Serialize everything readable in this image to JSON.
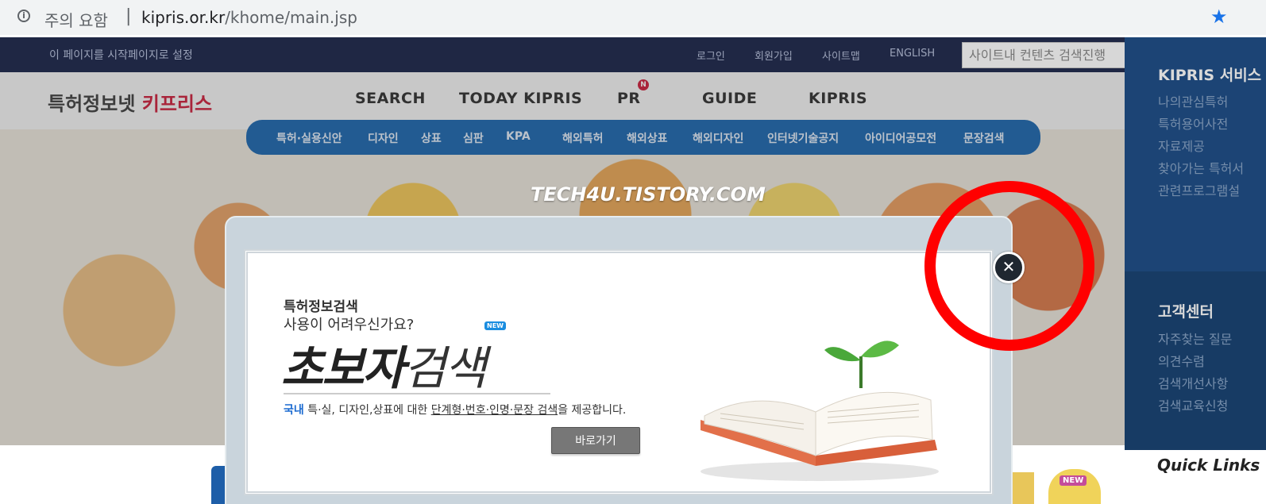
{
  "browser": {
    "security_label": "주의 요함",
    "separator": "|",
    "url_host": "kipris.or.kr",
    "url_path": "/khome/main.jsp"
  },
  "topbar": {
    "startpage_label": "이 페이지를 시작페이지로 설정",
    "links": [
      "로그인",
      "회원가입",
      "사이트맵",
      "ENGLISH"
    ],
    "search_placeholder": "사이트내 컨텐츠 검색진행"
  },
  "header": {
    "logo_main": "특허정보넷 ",
    "logo_accent": "키프리스",
    "nav": [
      "SEARCH",
      "TODAY KIPRIS",
      "PR",
      "GUIDE",
      "KIPRIS"
    ],
    "pr_badge": "N"
  },
  "subnav": [
    "특허·실용신안",
    "디자인",
    "상표",
    "심판",
    "KPA",
    "해외특허",
    "해외상표",
    "해외디자인",
    "인터넷기술공지",
    "아이디어공모전",
    "문장검색"
  ],
  "watermark": "TECH4U.TISTORY.COM",
  "right_panel": {
    "services_title": "KIPRIS 서비스",
    "services": [
      "나의관심특허",
      "특허용어사전",
      "자료제공",
      "찾아가는 특허서",
      "관련프로그램설"
    ],
    "support_title": "고객센터",
    "support": [
      "자주찾는 질문",
      "의견수렴",
      "검색개선사항",
      "검색교육신청"
    ],
    "quick_links": "Quick Links"
  },
  "new_tag": "NEW",
  "popup": {
    "small_title": "특허정보검색",
    "question": "사용이 어려우신가요?",
    "new_badge": "NEW",
    "big_bold": "초보자",
    "big_light": "검색",
    "desc_prefix": "국내",
    "desc_mid": " 특·실, 디자인,상표에 대한 ",
    "desc_ul": "단계형·번호·인명·문장 검색",
    "desc_suffix": "을 제공합니다.",
    "go_button": "바로가기",
    "close_glyph": "✕"
  },
  "colors": {
    "topbar_bg": "#1f2744",
    "subnav_bg": "#0d5ca8",
    "annotation_circle": "#ff0000",
    "accent_red": "#c8102e"
  }
}
